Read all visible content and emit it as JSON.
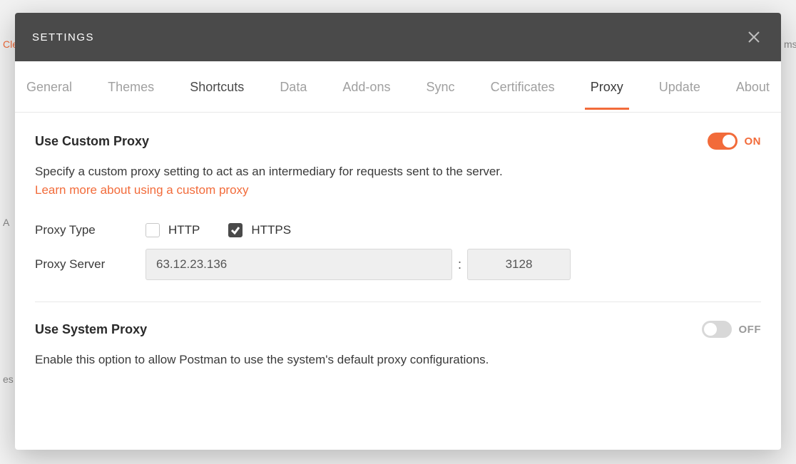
{
  "modal": {
    "title": "SETTINGS"
  },
  "tabs": [
    {
      "label": "General",
      "state": "normal"
    },
    {
      "label": "Themes",
      "state": "normal"
    },
    {
      "label": "Shortcuts",
      "state": "semi"
    },
    {
      "label": "Data",
      "state": "normal"
    },
    {
      "label": "Add-ons",
      "state": "normal"
    },
    {
      "label": "Sync",
      "state": "normal"
    },
    {
      "label": "Certificates",
      "state": "normal"
    },
    {
      "label": "Proxy",
      "state": "active"
    },
    {
      "label": "Update",
      "state": "normal"
    },
    {
      "label": "About",
      "state": "normal"
    }
  ],
  "customProxy": {
    "title": "Use Custom Proxy",
    "toggle_on": true,
    "toggle_label": "ON",
    "description": "Specify a custom proxy setting to act as an intermediary for requests sent to the server.",
    "learn_more": "Learn more about using a custom proxy",
    "type_label": "Proxy Type",
    "http_label": "HTTP",
    "http_checked": false,
    "https_label": "HTTPS",
    "https_checked": true,
    "server_label": "Proxy Server",
    "server_value": "63.12.23.136",
    "port_value": "3128"
  },
  "systemProxy": {
    "title": "Use System Proxy",
    "toggle_on": false,
    "toggle_label": "OFF",
    "description": "Enable this option to allow Postman to use the system's default proxy configurations."
  },
  "background": {
    "top_right": "ms",
    "left_mid_1": "Cle",
    "left_mid_2": "A",
    "left_mid_3": "es"
  }
}
